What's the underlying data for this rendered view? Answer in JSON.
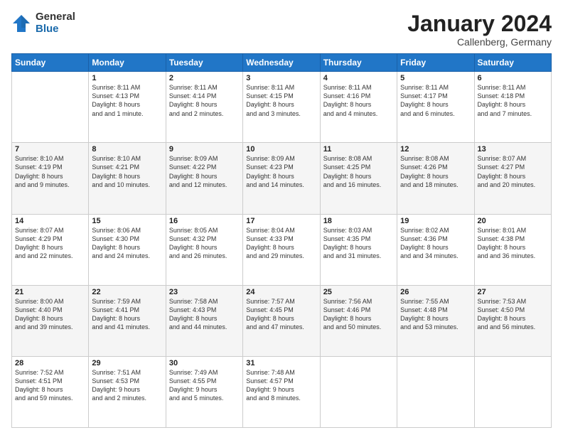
{
  "logo": {
    "general": "General",
    "blue": "Blue"
  },
  "header": {
    "month": "January 2024",
    "location": "Callenberg, Germany"
  },
  "weekdays": [
    "Sunday",
    "Monday",
    "Tuesday",
    "Wednesday",
    "Thursday",
    "Friday",
    "Saturday"
  ],
  "weeks": [
    [
      {
        "day": "",
        "sunrise": "",
        "sunset": "",
        "daylight": ""
      },
      {
        "day": "1",
        "sunrise": "Sunrise: 8:11 AM",
        "sunset": "Sunset: 4:13 PM",
        "daylight": "Daylight: 8 hours and 1 minute."
      },
      {
        "day": "2",
        "sunrise": "Sunrise: 8:11 AM",
        "sunset": "Sunset: 4:14 PM",
        "daylight": "Daylight: 8 hours and 2 minutes."
      },
      {
        "day": "3",
        "sunrise": "Sunrise: 8:11 AM",
        "sunset": "Sunset: 4:15 PM",
        "daylight": "Daylight: 8 hours and 3 minutes."
      },
      {
        "day": "4",
        "sunrise": "Sunrise: 8:11 AM",
        "sunset": "Sunset: 4:16 PM",
        "daylight": "Daylight: 8 hours and 4 minutes."
      },
      {
        "day": "5",
        "sunrise": "Sunrise: 8:11 AM",
        "sunset": "Sunset: 4:17 PM",
        "daylight": "Daylight: 8 hours and 6 minutes."
      },
      {
        "day": "6",
        "sunrise": "Sunrise: 8:11 AM",
        "sunset": "Sunset: 4:18 PM",
        "daylight": "Daylight: 8 hours and 7 minutes."
      }
    ],
    [
      {
        "day": "7",
        "sunrise": "Sunrise: 8:10 AM",
        "sunset": "Sunset: 4:19 PM",
        "daylight": "Daylight: 8 hours and 9 minutes."
      },
      {
        "day": "8",
        "sunrise": "Sunrise: 8:10 AM",
        "sunset": "Sunset: 4:21 PM",
        "daylight": "Daylight: 8 hours and 10 minutes."
      },
      {
        "day": "9",
        "sunrise": "Sunrise: 8:09 AM",
        "sunset": "Sunset: 4:22 PM",
        "daylight": "Daylight: 8 hours and 12 minutes."
      },
      {
        "day": "10",
        "sunrise": "Sunrise: 8:09 AM",
        "sunset": "Sunset: 4:23 PM",
        "daylight": "Daylight: 8 hours and 14 minutes."
      },
      {
        "day": "11",
        "sunrise": "Sunrise: 8:08 AM",
        "sunset": "Sunset: 4:25 PM",
        "daylight": "Daylight: 8 hours and 16 minutes."
      },
      {
        "day": "12",
        "sunrise": "Sunrise: 8:08 AM",
        "sunset": "Sunset: 4:26 PM",
        "daylight": "Daylight: 8 hours and 18 minutes."
      },
      {
        "day": "13",
        "sunrise": "Sunrise: 8:07 AM",
        "sunset": "Sunset: 4:27 PM",
        "daylight": "Daylight: 8 hours and 20 minutes."
      }
    ],
    [
      {
        "day": "14",
        "sunrise": "Sunrise: 8:07 AM",
        "sunset": "Sunset: 4:29 PM",
        "daylight": "Daylight: 8 hours and 22 minutes."
      },
      {
        "day": "15",
        "sunrise": "Sunrise: 8:06 AM",
        "sunset": "Sunset: 4:30 PM",
        "daylight": "Daylight: 8 hours and 24 minutes."
      },
      {
        "day": "16",
        "sunrise": "Sunrise: 8:05 AM",
        "sunset": "Sunset: 4:32 PM",
        "daylight": "Daylight: 8 hours and 26 minutes."
      },
      {
        "day": "17",
        "sunrise": "Sunrise: 8:04 AM",
        "sunset": "Sunset: 4:33 PM",
        "daylight": "Daylight: 8 hours and 29 minutes."
      },
      {
        "day": "18",
        "sunrise": "Sunrise: 8:03 AM",
        "sunset": "Sunset: 4:35 PM",
        "daylight": "Daylight: 8 hours and 31 minutes."
      },
      {
        "day": "19",
        "sunrise": "Sunrise: 8:02 AM",
        "sunset": "Sunset: 4:36 PM",
        "daylight": "Daylight: 8 hours and 34 minutes."
      },
      {
        "day": "20",
        "sunrise": "Sunrise: 8:01 AM",
        "sunset": "Sunset: 4:38 PM",
        "daylight": "Daylight: 8 hours and 36 minutes."
      }
    ],
    [
      {
        "day": "21",
        "sunrise": "Sunrise: 8:00 AM",
        "sunset": "Sunset: 4:40 PM",
        "daylight": "Daylight: 8 hours and 39 minutes."
      },
      {
        "day": "22",
        "sunrise": "Sunrise: 7:59 AM",
        "sunset": "Sunset: 4:41 PM",
        "daylight": "Daylight: 8 hours and 41 minutes."
      },
      {
        "day": "23",
        "sunrise": "Sunrise: 7:58 AM",
        "sunset": "Sunset: 4:43 PM",
        "daylight": "Daylight: 8 hours and 44 minutes."
      },
      {
        "day": "24",
        "sunrise": "Sunrise: 7:57 AM",
        "sunset": "Sunset: 4:45 PM",
        "daylight": "Daylight: 8 hours and 47 minutes."
      },
      {
        "day": "25",
        "sunrise": "Sunrise: 7:56 AM",
        "sunset": "Sunset: 4:46 PM",
        "daylight": "Daylight: 8 hours and 50 minutes."
      },
      {
        "day": "26",
        "sunrise": "Sunrise: 7:55 AM",
        "sunset": "Sunset: 4:48 PM",
        "daylight": "Daylight: 8 hours and 53 minutes."
      },
      {
        "day": "27",
        "sunrise": "Sunrise: 7:53 AM",
        "sunset": "Sunset: 4:50 PM",
        "daylight": "Daylight: 8 hours and 56 minutes."
      }
    ],
    [
      {
        "day": "28",
        "sunrise": "Sunrise: 7:52 AM",
        "sunset": "Sunset: 4:51 PM",
        "daylight": "Daylight: 8 hours and 59 minutes."
      },
      {
        "day": "29",
        "sunrise": "Sunrise: 7:51 AM",
        "sunset": "Sunset: 4:53 PM",
        "daylight": "Daylight: 9 hours and 2 minutes."
      },
      {
        "day": "30",
        "sunrise": "Sunrise: 7:49 AM",
        "sunset": "Sunset: 4:55 PM",
        "daylight": "Daylight: 9 hours and 5 minutes."
      },
      {
        "day": "31",
        "sunrise": "Sunrise: 7:48 AM",
        "sunset": "Sunset: 4:57 PM",
        "daylight": "Daylight: 9 hours and 8 minutes."
      },
      {
        "day": "",
        "sunrise": "",
        "sunset": "",
        "daylight": ""
      },
      {
        "day": "",
        "sunrise": "",
        "sunset": "",
        "daylight": ""
      },
      {
        "day": "",
        "sunrise": "",
        "sunset": "",
        "daylight": ""
      }
    ]
  ]
}
